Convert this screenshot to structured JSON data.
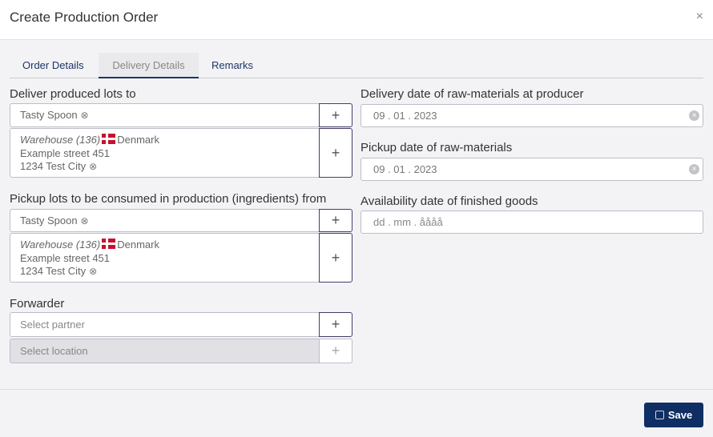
{
  "dialog": {
    "title": "Create Production Order",
    "close": "×"
  },
  "tabs": [
    {
      "label": "Order Details"
    },
    {
      "label": "Delivery Details"
    },
    {
      "label": "Remarks"
    }
  ],
  "deliver": {
    "label": "Deliver produced lots to",
    "partner": "Tasty Spoon",
    "location_type": "Warehouse (136)",
    "country": "Denmark",
    "street": "Example street 451",
    "city": "1234 Test City"
  },
  "pickup": {
    "label": "Pickup lots to be consumed in production (ingredients) from",
    "partner": "Tasty Spoon",
    "location_type": "Warehouse (136)",
    "country": "Denmark",
    "street": "Example street 451",
    "city": "1234 Test City"
  },
  "forwarder": {
    "label": "Forwarder",
    "partner_placeholder": "Select partner",
    "location_placeholder": "Select location"
  },
  "dates": {
    "delivery_label": "Delivery date of raw-materials at producer",
    "delivery_value": "09 . 01 . 2023",
    "pickup_label": "Pickup date of raw-materials",
    "pickup_value": "09 . 01 . 2023",
    "availability_label": "Availability date of finished goods",
    "availability_placeholder": "dd . mm . åååå"
  },
  "icons": {
    "plus": "+",
    "clear": "⊗",
    "clear_filled": "×"
  },
  "footer": {
    "save_label": "Save"
  }
}
